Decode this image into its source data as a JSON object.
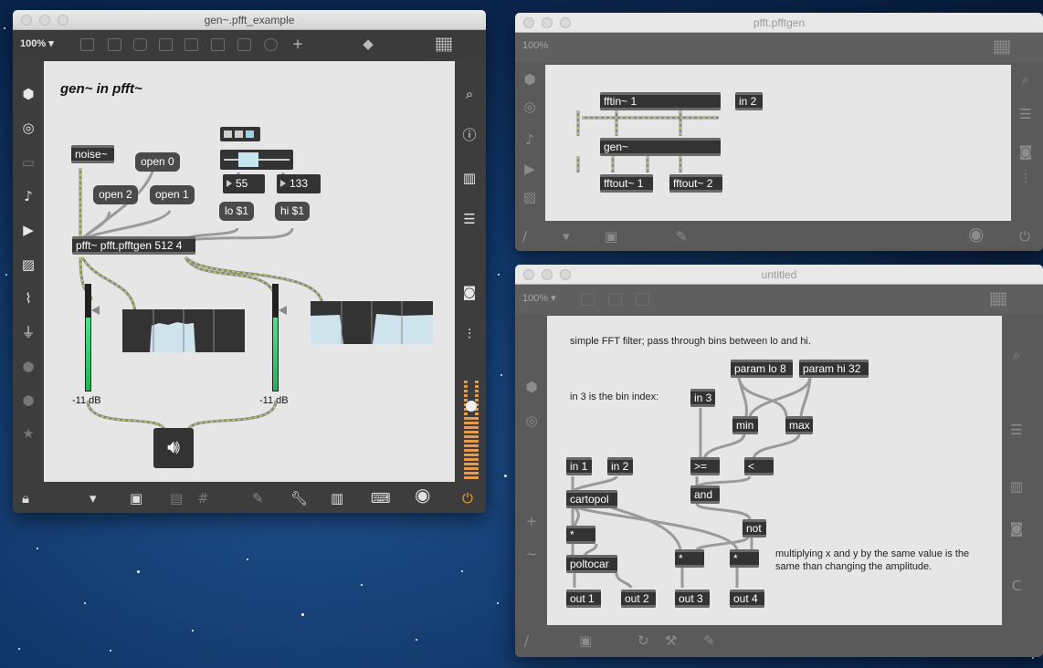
{
  "windows": {
    "main": {
      "title": "gen~.pfft_example",
      "zoom": "100% ▾",
      "heading": "gen~ in pfft~",
      "objects": {
        "noise": "noise~",
        "pfft": "pfft~ pfft.pfftgen 512 4"
      },
      "messages": {
        "open0": "open 0",
        "open2": "open 2",
        "open1": "open 1",
        "lo": "lo $1",
        "hi": "hi $1"
      },
      "numbers": {
        "lo_value": "55",
        "hi_value": "133"
      },
      "meters": {
        "left_db": "-11 dB",
        "right_db": "-11 dB"
      }
    },
    "pfftgen": {
      "title": "pfft.pfftgen",
      "zoom": "100%",
      "objects": {
        "fftin": "fftin~ 1",
        "in2": "in 2",
        "gen": "gen~",
        "fftout1": "fftout~ 1",
        "fftout2": "fftout~ 2"
      }
    },
    "untitled": {
      "title": "untitled",
      "zoom": "100% ▾",
      "comments": {
        "intro": "simple FFT filter; pass through bins between lo and hi.",
        "bin_index": "in 3 is the bin index:",
        "note_line1": "multiplying x and y by the same value is the",
        "note_line2": "same than changing the amplitude."
      },
      "objects": {
        "param_lo": "param lo 8",
        "param_hi": "param hi 32",
        "in3": "in 3",
        "min": "min",
        "max": "max",
        "in1": "in 1",
        "in2": "in 2",
        "gte": ">=",
        "lt": "<",
        "cartopol": "cartopol",
        "and": "and",
        "not": "not",
        "mul1": "*",
        "mul2": "*",
        "mul3": "*",
        "poltocar": "poltocar",
        "out1": "out 1",
        "out2": "out 2",
        "out3": "out 3",
        "out4": "out 4"
      }
    }
  },
  "colors": {
    "object_bg": "#333333",
    "canvas_bg": "#e6e6e6",
    "meter_green": "#2ccf6a",
    "power_orange": "#f0a030",
    "patchcord_signal": "#b8c94a"
  }
}
